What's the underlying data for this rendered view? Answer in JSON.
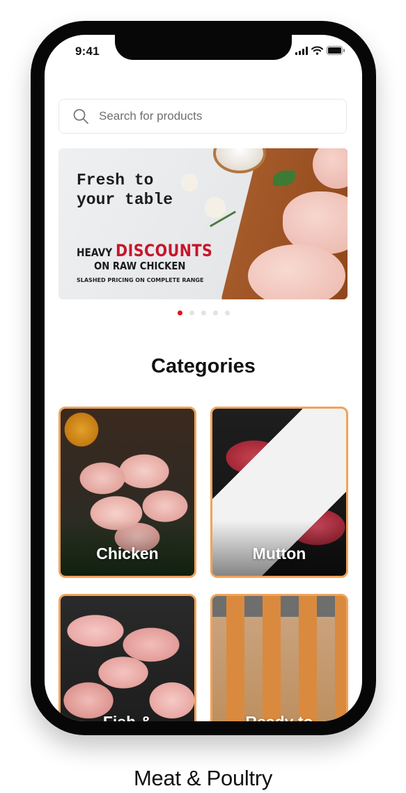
{
  "status_bar": {
    "time": "9:41"
  },
  "search": {
    "placeholder": "Search for products"
  },
  "banner": {
    "title": "Fresh to\nyour table",
    "heavy": "HEAVY",
    "discounts": "DISCOUNTS",
    "subtitle": "ON RAW CHICKEN",
    "small_text": "SLASHED PRICING ON COMPLETE RANGE"
  },
  "carousel": {
    "total": 5,
    "active_index": 0
  },
  "categories": {
    "title": "Categories",
    "items": [
      {
        "label": "Chicken"
      },
      {
        "label": "Mutton"
      },
      {
        "label": "Fish &"
      },
      {
        "label": "Ready to"
      }
    ]
  },
  "colors": {
    "accent": "#e0131d",
    "card_border": "#f0a35a"
  },
  "footer": {
    "caption": "Meat & Poultry"
  }
}
